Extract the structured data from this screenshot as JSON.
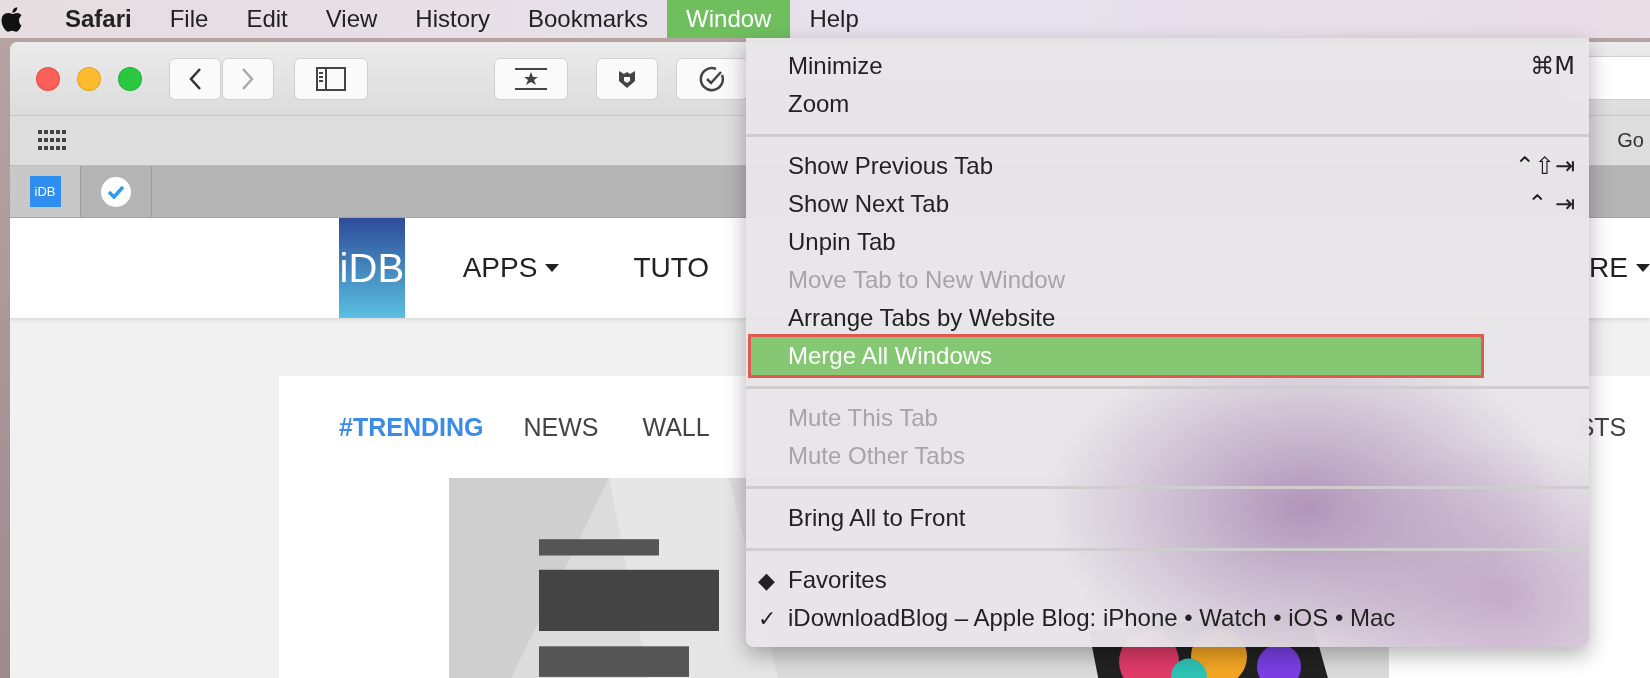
{
  "menubar": {
    "items": [
      {
        "label": "Safari",
        "kind": "app",
        "selected": false
      },
      {
        "label": "File",
        "kind": "menu",
        "selected": false
      },
      {
        "label": "Edit",
        "kind": "menu",
        "selected": false
      },
      {
        "label": "View",
        "kind": "menu",
        "selected": false
      },
      {
        "label": "History",
        "kind": "menu",
        "selected": false
      },
      {
        "label": "Bookmarks",
        "kind": "menu",
        "selected": false
      },
      {
        "label": "Window",
        "kind": "menu",
        "selected": true
      },
      {
        "label": "Help",
        "kind": "menu",
        "selected": false
      }
    ]
  },
  "bookmarks_bar": {
    "items": [
      "Go"
    ]
  },
  "pinned_tabs": [
    {
      "kind": "logo",
      "label": "iDB",
      "selected": true
    },
    {
      "kind": "check",
      "selected": false
    }
  ],
  "site_header": {
    "logo": "iDB",
    "nav": [
      {
        "label": "APPS",
        "dropdown": true
      },
      {
        "label": "TUTO",
        "dropdown": false
      },
      {
        "label": "RE",
        "dropdown": true
      }
    ]
  },
  "trending_bar": [
    {
      "label": "#TRENDING",
      "selected": true
    },
    {
      "label": "NEWS",
      "selected": false
    },
    {
      "label": "WALL",
      "selected": false
    },
    {
      "label": "STS",
      "selected": false
    }
  ],
  "window_menu": [
    {
      "kind": "item",
      "label": "Minimize",
      "shortcut": "⌘M",
      "disabled": false,
      "selected": false
    },
    {
      "kind": "item",
      "label": "Zoom",
      "disabled": false,
      "selected": false
    },
    {
      "kind": "separator"
    },
    {
      "kind": "item",
      "label": "Show Previous Tab",
      "shortcut": "⌃⇧⇥",
      "disabled": false,
      "selected": false
    },
    {
      "kind": "item",
      "label": "Show Next Tab",
      "shortcut": "⌃ ⇥",
      "disabled": false,
      "selected": false
    },
    {
      "kind": "item",
      "label": "Unpin Tab",
      "disabled": false,
      "selected": false
    },
    {
      "kind": "item",
      "label": "Move Tab to New Window",
      "disabled": true,
      "selected": false
    },
    {
      "kind": "item",
      "label": "Arrange Tabs by Website",
      "disabled": false,
      "selected": false
    },
    {
      "kind": "item",
      "label": "Merge All Windows",
      "disabled": false,
      "selected": true
    },
    {
      "kind": "separator"
    },
    {
      "kind": "item",
      "label": "Mute This Tab",
      "disabled": true,
      "selected": false
    },
    {
      "kind": "item",
      "label": "Mute Other Tabs",
      "disabled": true,
      "selected": false
    },
    {
      "kind": "separator"
    },
    {
      "kind": "item",
      "label": "Bring All to Front",
      "disabled": false,
      "selected": false
    },
    {
      "kind": "separator"
    },
    {
      "kind": "item",
      "label": "Favorites",
      "mark": "◆",
      "disabled": false,
      "selected": false
    },
    {
      "kind": "item",
      "label": "iDownloadBlog – Apple Blog: iPhone • Watch • iOS • Mac",
      "mark": "✓",
      "disabled": false,
      "selected": false
    }
  ]
}
